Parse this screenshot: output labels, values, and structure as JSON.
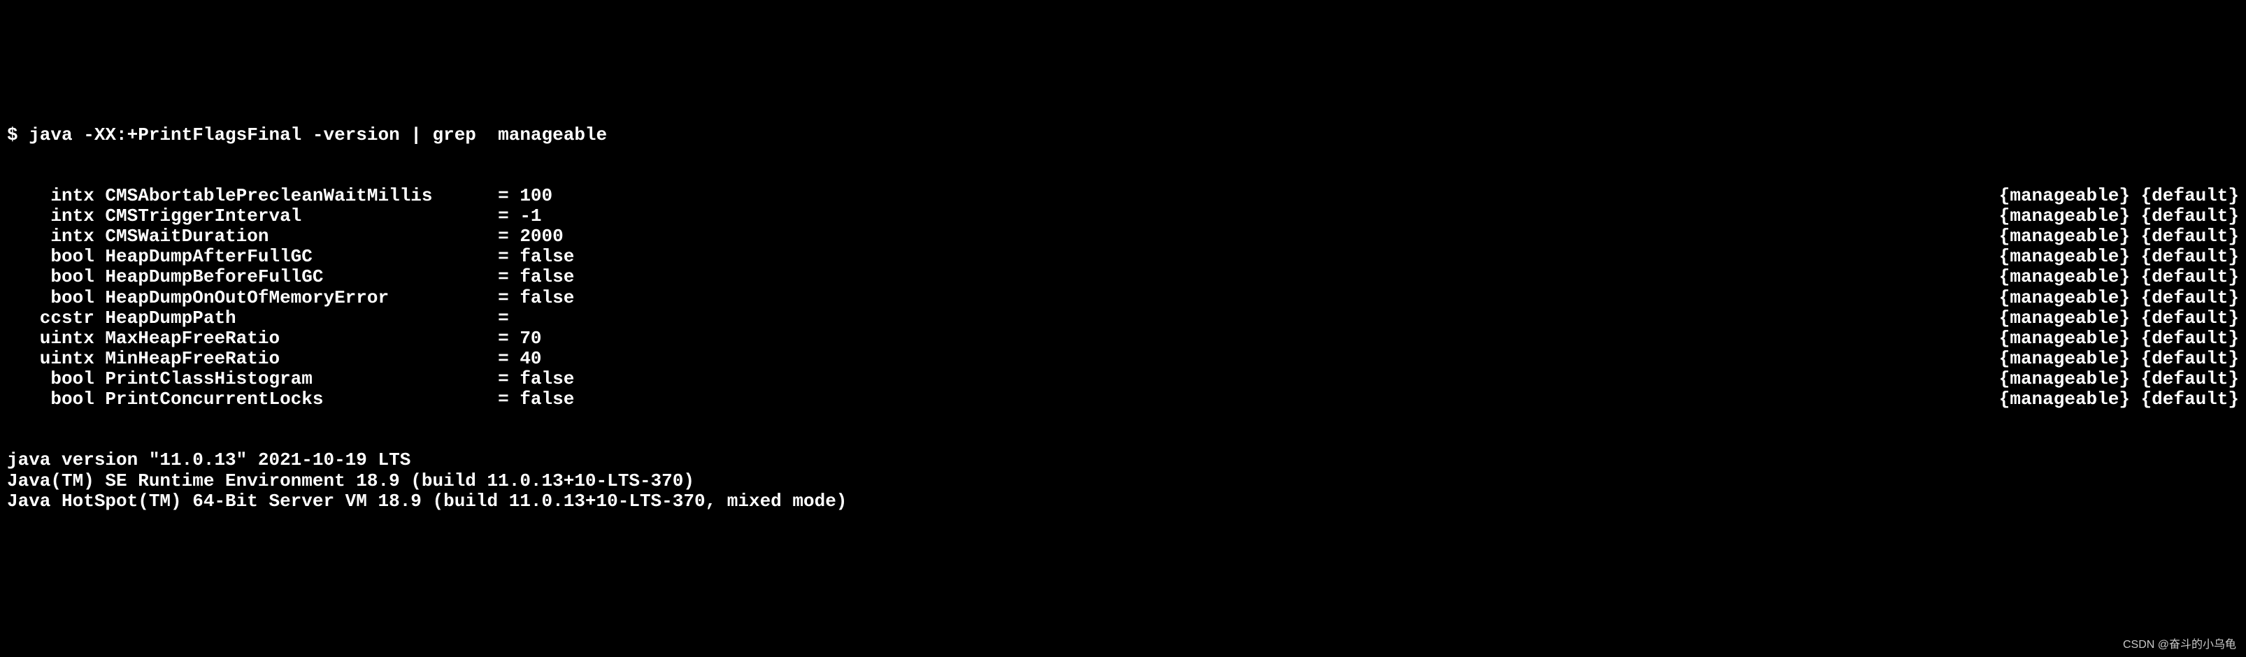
{
  "prompt": "$ java -XX:+PrintFlagsFinal -version | grep  manageable",
  "flags": [
    {
      "type": "intx",
      "name": "CMSAbortablePrecleanWaitMillis",
      "value": "100",
      "cat": "{manageable}",
      "origin": "{default}"
    },
    {
      "type": "intx",
      "name": "CMSTriggerInterval",
      "value": "-1",
      "cat": "{manageable}",
      "origin": "{default}"
    },
    {
      "type": "intx",
      "name": "CMSWaitDuration",
      "value": "2000",
      "cat": "{manageable}",
      "origin": "{default}"
    },
    {
      "type": "bool",
      "name": "HeapDumpAfterFullGC",
      "value": "false",
      "cat": "{manageable}",
      "origin": "{default}"
    },
    {
      "type": "bool",
      "name": "HeapDumpBeforeFullGC",
      "value": "false",
      "cat": "{manageable}",
      "origin": "{default}"
    },
    {
      "type": "bool",
      "name": "HeapDumpOnOutOfMemoryError",
      "value": "false",
      "cat": "{manageable}",
      "origin": "{default}"
    },
    {
      "type": "ccstr",
      "name": "HeapDumpPath",
      "value": "",
      "cat": "{manageable}",
      "origin": "{default}"
    },
    {
      "type": "uintx",
      "name": "MaxHeapFreeRatio",
      "value": "70",
      "cat": "{manageable}",
      "origin": "{default}"
    },
    {
      "type": "uintx",
      "name": "MinHeapFreeRatio",
      "value": "40",
      "cat": "{manageable}",
      "origin": "{default}"
    },
    {
      "type": "bool",
      "name": "PrintClassHistogram",
      "value": "false",
      "cat": "{manageable}",
      "origin": "{default}"
    },
    {
      "type": "bool",
      "name": "PrintConcurrentLocks",
      "value": "false",
      "cat": "{manageable}",
      "origin": "{default}"
    }
  ],
  "version_lines": [
    "java version \"11.0.13\" 2021-10-19 LTS",
    "Java(TM) SE Runtime Environment 18.9 (build 11.0.13+10-LTS-370)",
    "Java HotSpot(TM) 64-Bit Server VM 18.9 (build 11.0.13+10-LTS-370, mixed mode)"
  ],
  "watermark": "CSDN @奋斗的小乌龟",
  "layout": {
    "type_col_width": 8,
    "name_col_width": 36,
    "eq_col_start": 44,
    "val_col_gap": 1
  }
}
